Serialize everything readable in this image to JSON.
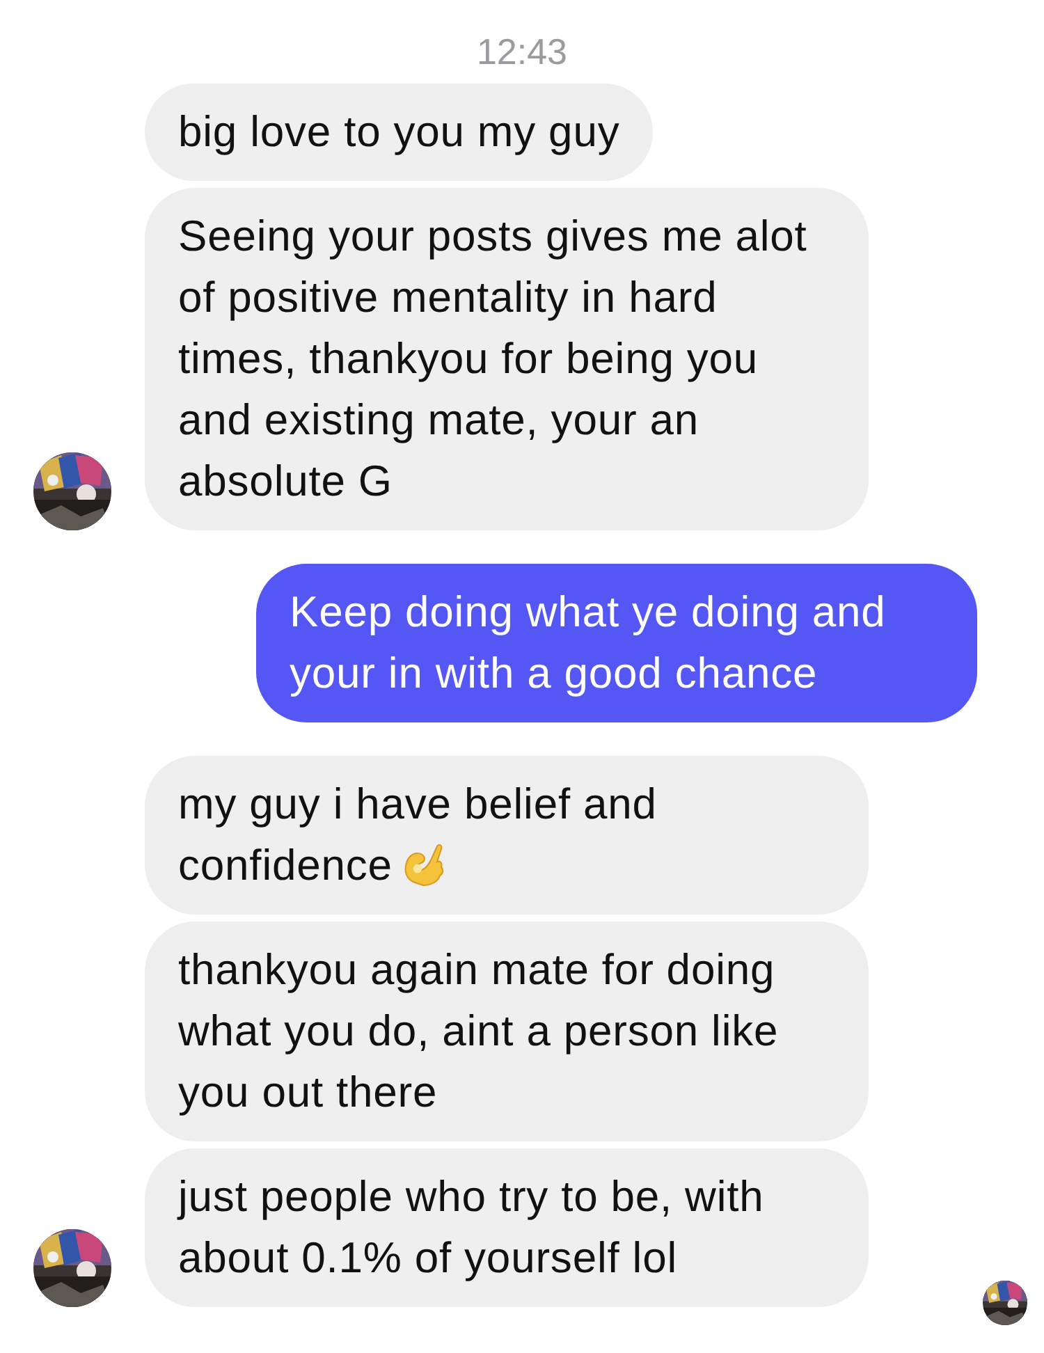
{
  "timestamp": "12:43",
  "groups": [
    {
      "kind": "incoming",
      "avatar": true,
      "messages": [
        {
          "text": "big love to you my guy",
          "emoji": false
        },
        {
          "text": "Seeing your posts gives me alot of positive mentality in hard times, thankyou for being you and existing mate, your an absolute G",
          "emoji": false
        }
      ]
    },
    {
      "kind": "outgoing",
      "avatar": false,
      "messages": [
        {
          "text": "Keep doing what ye doing and your in with a good chance",
          "emoji": false
        }
      ]
    },
    {
      "kind": "incoming",
      "avatar": true,
      "messages": [
        {
          "text": "my guy i have belief and confidence",
          "emoji": true
        },
        {
          "text": "thankyou again mate for doing what you do, aint a person like you out there",
          "emoji": false
        },
        {
          "text": "just people who try to be, with about 0.1% of yourself lol",
          "emoji": false
        }
      ]
    }
  ],
  "read_receipt": true
}
